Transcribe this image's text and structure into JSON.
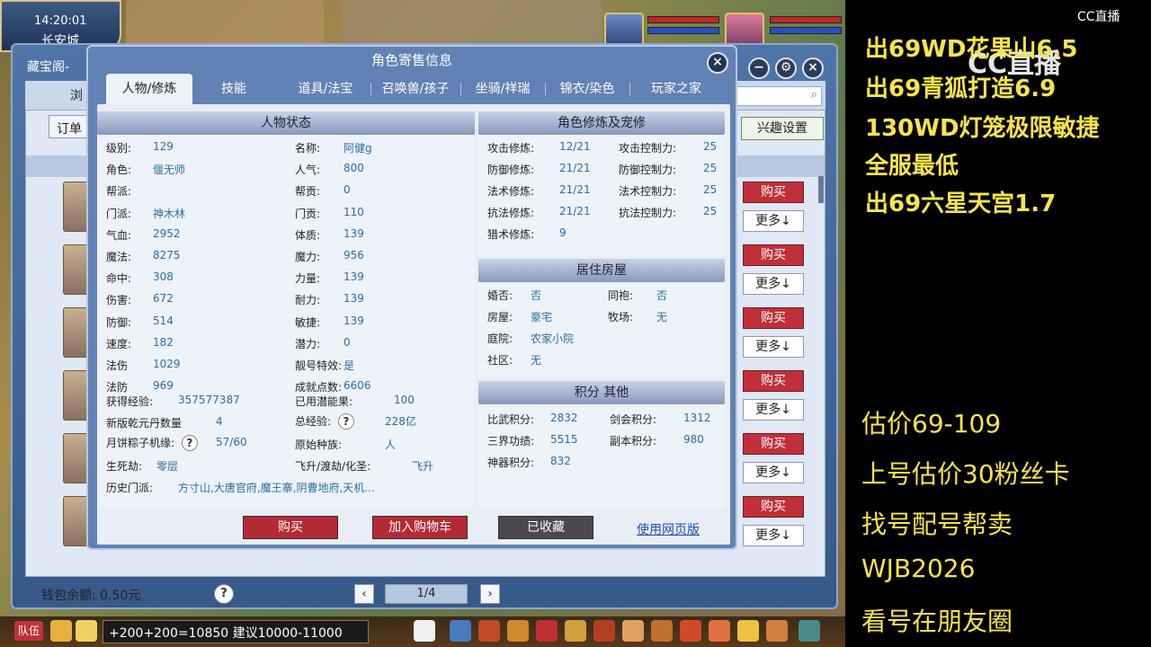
{
  "hud": {
    "time": "14:20:01",
    "city": "长安城"
  },
  "bg_window": {
    "title": "藏宝阁-",
    "tab_partial": "浏",
    "order_btn": "订单",
    "interest_btn": "兴趣设置",
    "buy_label": "购买",
    "more_label": "更多↓",
    "wallet": "钱包余额: 0.50元",
    "help": "?",
    "page": "1/4",
    "prev": "‹",
    "next": "›"
  },
  "dialog": {
    "title": "角色寄售信息",
    "close": "×",
    "tabs": [
      "人物/修炼",
      "技能",
      "道具/法宝",
      "召唤兽/孩子",
      "坐骑/祥瑞",
      "锦衣/染色",
      "玩家之家"
    ],
    "status": {
      "head": "人物状态",
      "left": [
        {
          "k": "级别:",
          "v": "129"
        },
        {
          "k": "角色:",
          "v": "偃无师"
        },
        {
          "k": "帮派:",
          "v": ""
        },
        {
          "k": "门派:",
          "v": "神木林"
        },
        {
          "k": "气血:",
          "v": "2952"
        },
        {
          "k": "魔法:",
          "v": "8275"
        },
        {
          "k": "命中:",
          "v": "308"
        },
        {
          "k": "伤害:",
          "v": "672"
        },
        {
          "k": "防御:",
          "v": "514"
        },
        {
          "k": "速度:",
          "v": "182"
        },
        {
          "k": "法伤",
          "v": "1029"
        },
        {
          "k": "法防",
          "v": "969"
        }
      ],
      "right": [
        {
          "k": "名称:",
          "v": "阿健g"
        },
        {
          "k": "人气:",
          "v": "800"
        },
        {
          "k": "帮贡:",
          "v": "0"
        },
        {
          "k": "门贡:",
          "v": "110"
        },
        {
          "k": "体质:",
          "v": "139"
        },
        {
          "k": "魔力:",
          "v": "956"
        },
        {
          "k": "力量:",
          "v": "139"
        },
        {
          "k": "耐力:",
          "v": "139"
        },
        {
          "k": "敏捷:",
          "v": "139"
        },
        {
          "k": "潜力:",
          "v": "0"
        },
        {
          "k": "靓号特效:",
          "v": "是"
        },
        {
          "k": "成就点数:",
          "v": "6606"
        }
      ],
      "exp_label": "获得经验:",
      "exp": "357577387",
      "potential_label": "已用潜能果:",
      "potential": "100",
      "qiankun_label": "新版乾元丹数量",
      "qiankun": "4",
      "total_exp_label": "总经验:",
      "total_exp": "228亿",
      "mooncake_label": "月饼粽子机缘:",
      "mooncake": "57/60",
      "race_label": "原始种族:",
      "race": "人",
      "life_label": "生死劫:",
      "life": "零层",
      "fly_label": "飞升/渡劫/化圣:",
      "fly": "飞升",
      "history_label": "历史门派:",
      "history": "方寸山,大唐官府,魔王寨,阴曹地府,天机..."
    },
    "cultivation": {
      "head": "角色修炼及宠修",
      "left": [
        {
          "k": "攻击修炼:",
          "v": "12/21"
        },
        {
          "k": "防御修炼:",
          "v": "21/21"
        },
        {
          "k": "法术修炼:",
          "v": "21/21"
        },
        {
          "k": "抗法修炼:",
          "v": "21/21"
        },
        {
          "k": "猎术修炼:",
          "v": "9"
        }
      ],
      "right": [
        {
          "k": "攻击控制力:",
          "v": "25"
        },
        {
          "k": "防御控制力:",
          "v": "25"
        },
        {
          "k": "法术控制力:",
          "v": "25"
        },
        {
          "k": "抗法控制力:",
          "v": "25"
        }
      ]
    },
    "house": {
      "head": "居住房屋",
      "rows": [
        {
          "k": "婚否:",
          "v": "否",
          "k2": "同袍:",
          "v2": "否"
        },
        {
          "k": "房屋:",
          "v": "豪宅",
          "k2": "牧场:",
          "v2": "无"
        },
        {
          "k": "庭院:",
          "v": "农家小院",
          "k2": "",
          "v2": ""
        },
        {
          "k": "社区:",
          "v": "无",
          "k2": "",
          "v2": ""
        }
      ]
    },
    "points": {
      "head": "积分 其他",
      "rows": [
        {
          "k": "比武积分:",
          "v": "2832",
          "k2": "剑会积分:",
          "v2": "1312"
        },
        {
          "k": "三界功绩:",
          "v": "5515",
          "k2": "副本积分:",
          "v2": "980"
        },
        {
          "k": "神器积分:",
          "v": "832",
          "k2": "",
          "v2": ""
        }
      ]
    },
    "buttons": {
      "buy": "购买",
      "cart": "加入购物车",
      "fav": "已收藏",
      "web": "使用网页版"
    }
  },
  "bottom": {
    "team": "队伍",
    "chat": "+200+200=10850 建议10000-11000"
  },
  "overlay": {
    "logo_small": "CC直播",
    "logo_big": "CC直播",
    "lines_bold": [
      "出69WD花果山6.5",
      "出69青狐打造6.9",
      "130WD灯笼极限敏捷",
      "全服最低",
      "出69六星天宫1.7"
    ],
    "lines": [
      "估价69-109",
      "上号估价30粉丝卡",
      "找号配号帮卖",
      " WJB2026",
      "看号在朋友圈"
    ]
  },
  "colors": {
    "accent_text": "#2a6fa0",
    "overlay_yellow": "#f6e44a",
    "buy_red": "#c0303a",
    "dialog_blue": "#6281b4"
  }
}
